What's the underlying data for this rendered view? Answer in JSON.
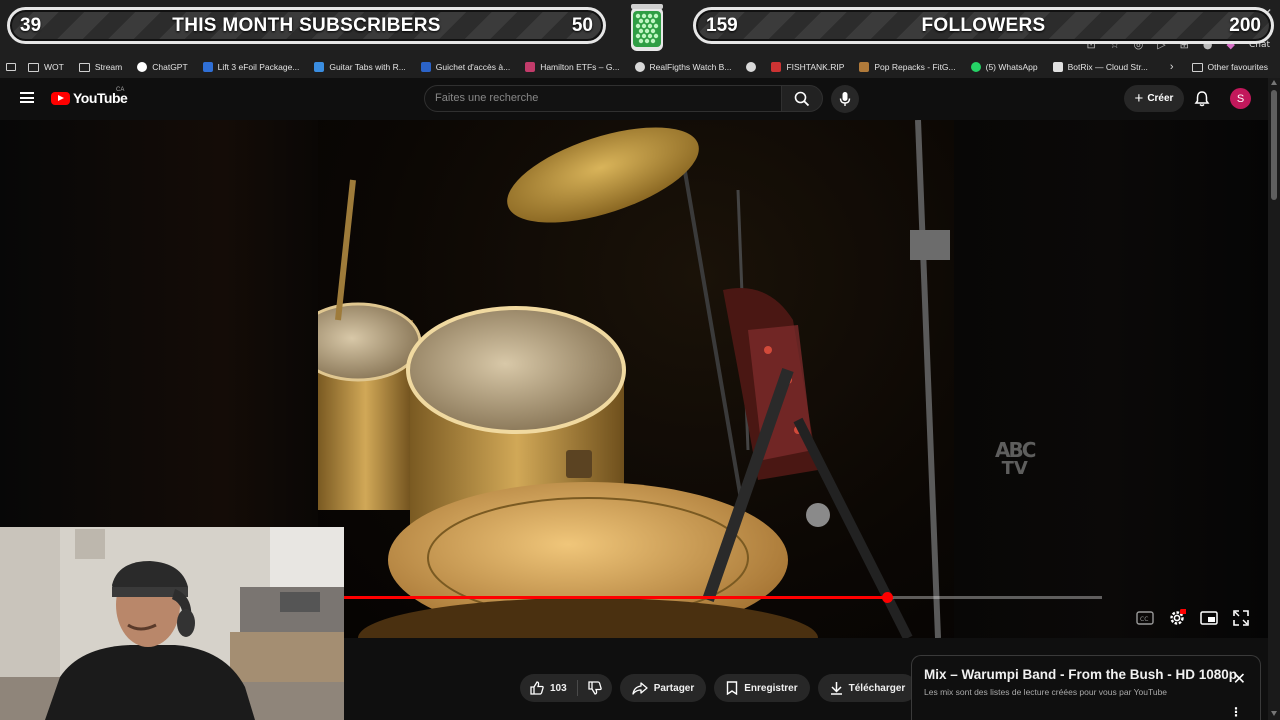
{
  "overlay": {
    "left": {
      "current": "39",
      "label": "THIS MONTH SUBSCRIBERS",
      "goal": "50"
    },
    "right": {
      "current": "159",
      "label": "FOLLOWERS",
      "goal": "200"
    }
  },
  "browser": {
    "extension_chat_label": "Chat",
    "bookmarks": [
      {
        "label": "WOT",
        "icon": "folder-icon"
      },
      {
        "label": "Stream",
        "icon": "folder-icon"
      },
      {
        "label": "ChatGPT",
        "icon": "chatgpt-icon",
        "color": "#ffffff"
      },
      {
        "label": "Lift 3 eFoil Package...",
        "icon": "site-icon",
        "color": "#2f6fd6"
      },
      {
        "label": "Guitar Tabs with R...",
        "icon": "site-icon",
        "color": "#3a8de0"
      },
      {
        "label": "Guichet d'accès à...",
        "icon": "gov-icon",
        "color": "#2b63c8"
      },
      {
        "label": "Hamilton ETFs – G...",
        "icon": "site-icon",
        "color": "#c23b6a"
      },
      {
        "label": "RealFigths Watch B...",
        "icon": "wordpress-icon",
        "color": "#d8d8d8"
      },
      {
        "label": "",
        "icon": "globe-icon",
        "color": "#d8d8d8"
      },
      {
        "label": "FISHTANK.RIP",
        "icon": "site-icon",
        "color": "#cc3333"
      },
      {
        "label": "Pop Repacks - FitG...",
        "icon": "site-icon",
        "color": "#b07a3a"
      },
      {
        "label": "(5) WhatsApp",
        "icon": "whatsapp-icon",
        "color": "#25d366"
      },
      {
        "label": "BotRix — Cloud Str...",
        "icon": "site-icon",
        "color": "#e0e0e0"
      }
    ],
    "other_favourites": "Other favourites"
  },
  "youtube": {
    "logo_text": "YouTube",
    "region": "CA",
    "search_placeholder": "Faites une recherche",
    "create_label": "Créer",
    "avatar_letter": "S"
  },
  "player": {
    "progress_fraction": 0.716,
    "buffer_fraction": 1.0,
    "watermark_top": "ABC",
    "watermark_bottom": "TV"
  },
  "actions": {
    "like_count": "103",
    "share_label": "Partager",
    "save_label": "Enregistrer",
    "download_label": "Télécharger"
  },
  "mix": {
    "title": "Mix – Warumpi Band - From the Bush - HD 1080p",
    "subtitle": "Les mix sont des listes de lecture créées pour vous par YouTube"
  },
  "colors": {
    "accent_red": "#ff0000",
    "avatar_bg": "#c2185b",
    "pill_bg": "#272727"
  }
}
